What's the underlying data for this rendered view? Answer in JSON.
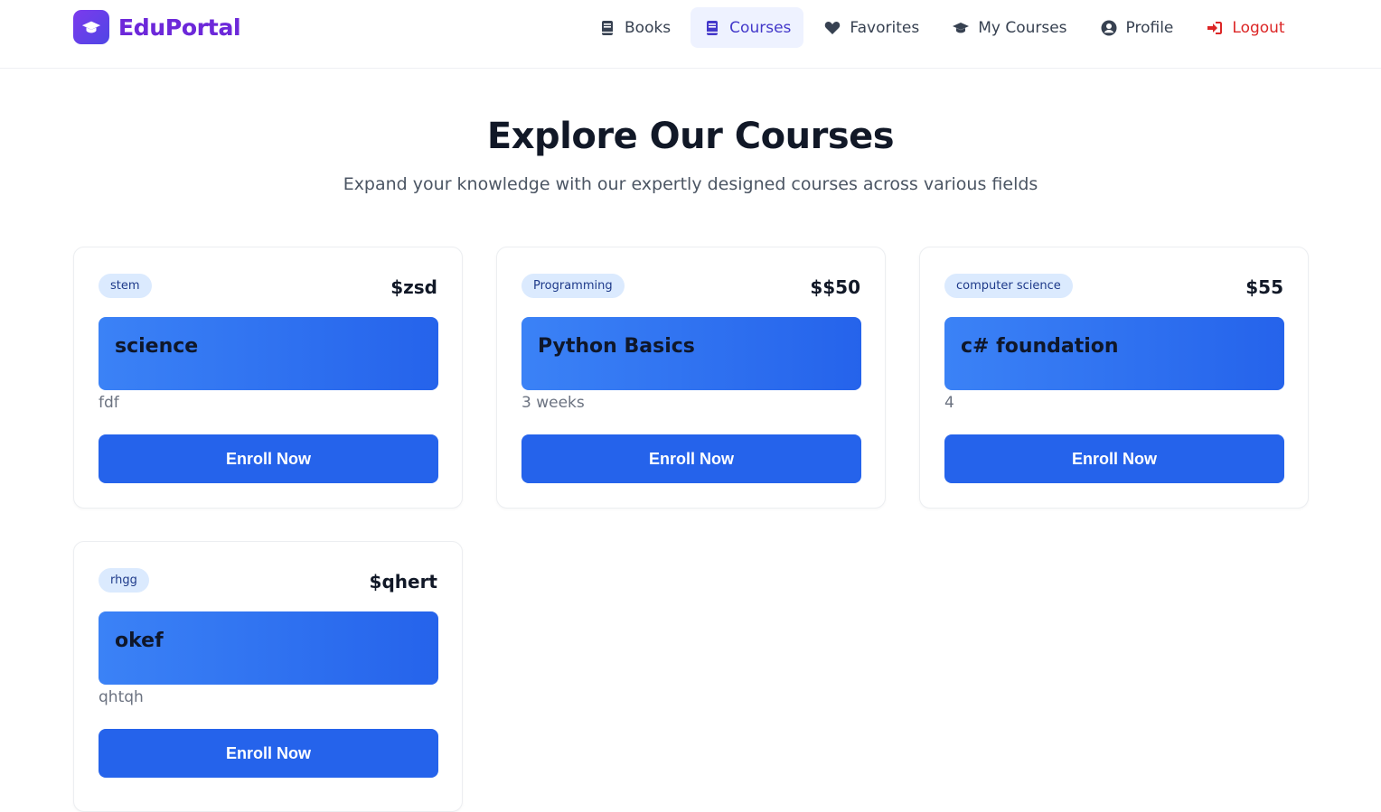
{
  "brand": {
    "name": "EduPortal",
    "icon": "graduation-cap-icon"
  },
  "nav": {
    "items": [
      {
        "label": "Books",
        "icon": "book-icon"
      },
      {
        "label": "Courses",
        "icon": "book-icon",
        "active": true
      },
      {
        "label": "Favorites",
        "icon": "heart-icon"
      },
      {
        "label": "My Courses",
        "icon": "graduation-cap-icon"
      },
      {
        "label": "Profile",
        "icon": "user-circle-icon"
      },
      {
        "label": "Logout",
        "icon": "logout-icon"
      }
    ]
  },
  "hero": {
    "title": "Explore Our Courses",
    "subtitle": "Expand your knowledge with our expertly designed courses across various fields"
  },
  "courses": [
    {
      "category": "stem",
      "price": "$zsd",
      "title": "science",
      "duration": "fdf",
      "button": "Enroll Now"
    },
    {
      "category": "Programming",
      "price": "$$50",
      "title": "Python Basics",
      "duration": "3 weeks",
      "button": "Enroll Now"
    },
    {
      "category": "computer science",
      "price": "$55",
      "title": "c# foundation",
      "duration": "4",
      "button": "Enroll Now"
    },
    {
      "category": "rhgg",
      "price": "$qhert",
      "title": "okef",
      "duration": "qhtqh",
      "button": "Enroll Now"
    }
  ],
  "colors": {
    "brand": "#6d28d9",
    "primary": "#2563eb",
    "active_nav_bg": "#eef2ff",
    "logout": "#dc2626",
    "tag_bg": "#dbeafe"
  }
}
